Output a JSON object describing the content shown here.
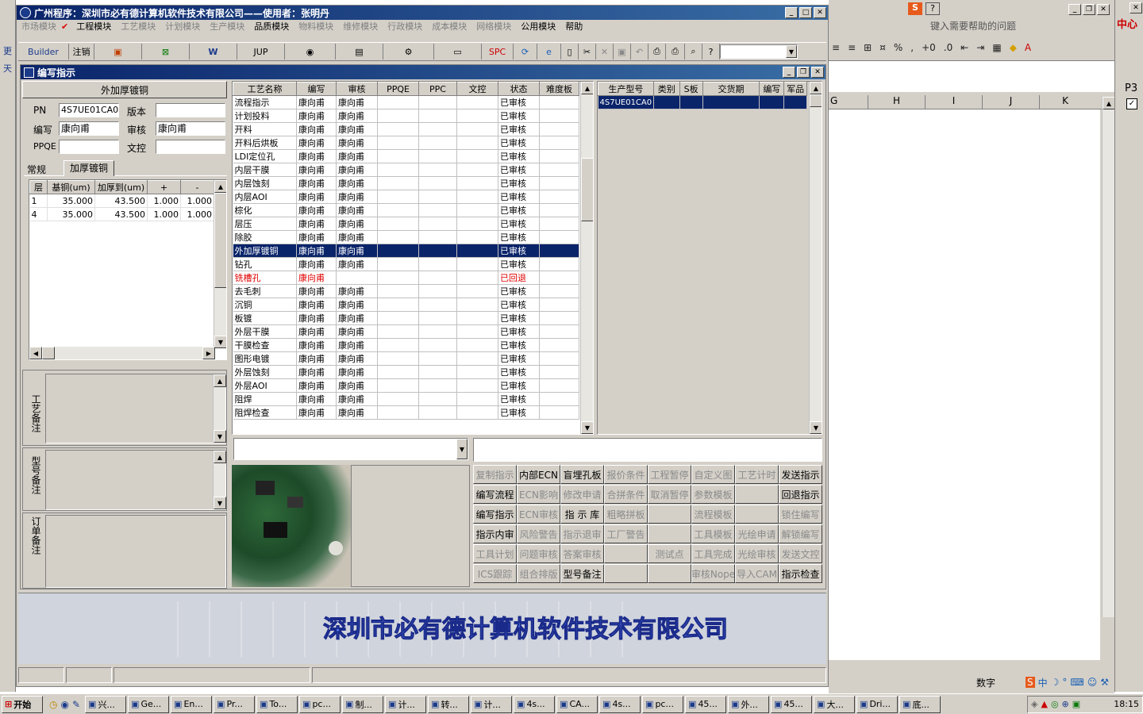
{
  "main_title": "广州程序：深圳市必有德计算机软件技术有限公司——使用者：张明丹",
  "menu": [
    {
      "label": "市场模块",
      "dis": true
    },
    {
      "label": "工程模块",
      "dis": false
    },
    {
      "label": "工艺模块",
      "dis": true
    },
    {
      "label": "计划模块",
      "dis": true
    },
    {
      "label": "生产模块",
      "dis": true
    },
    {
      "label": "品质模块",
      "dis": false
    },
    {
      "label": "物料模块",
      "dis": true
    },
    {
      "label": "维修模块",
      "dis": true
    },
    {
      "label": "行政模块",
      "dis": true
    },
    {
      "label": "成本模块",
      "dis": true
    },
    {
      "label": "网络模块",
      "dis": true
    },
    {
      "label": "公用模块",
      "dis": false
    },
    {
      "label": "帮助",
      "dis": false
    }
  ],
  "toolbar": {
    "builder": "Builder",
    "logout": "注销",
    "jup": "JUP",
    "spc": "SPC"
  },
  "child_title": "编写指示",
  "left": {
    "section_title": "外加厚镀铜",
    "pn_label": "PN",
    "pn_value": "4S7UE01CA0",
    "version_label": "版本",
    "version_value": "",
    "writer_label": "编写",
    "writer_value": "康向甫",
    "review_label": "审核",
    "review_value": "康向甫",
    "ppqe_label": "PPQE",
    "ppqe_value": "",
    "doc_label": "文控",
    "doc_value": "",
    "tabs": [
      "常规",
      "加厚镀铜"
    ],
    "layer_headers": [
      "层",
      "基铜(um)",
      "加厚到(um)",
      "+",
      "-"
    ],
    "layer_rows": [
      [
        "1",
        "35.000",
        "43.500",
        "1.000",
        "1.000"
      ],
      [
        "4",
        "35.000",
        "43.500",
        "1.000",
        "1.000"
      ]
    ],
    "note_labels": [
      "工艺备注",
      "型号备注",
      "订单备注"
    ]
  },
  "process": {
    "headers": [
      "工艺名称",
      "编写",
      "审核",
      "PPQE",
      "PPC",
      "文控",
      "状态",
      "难度板"
    ],
    "rows": [
      [
        "流程指示",
        "康向甫",
        "康向甫",
        "",
        "",
        "",
        "已审核",
        ""
      ],
      [
        "计划投料",
        "康向甫",
        "康向甫",
        "",
        "",
        "",
        "已审核",
        ""
      ],
      [
        "开料",
        "康向甫",
        "康向甫",
        "",
        "",
        "",
        "已审核",
        ""
      ],
      [
        "开料后烘板",
        "康向甫",
        "康向甫",
        "",
        "",
        "",
        "已审核",
        ""
      ],
      [
        "LDI定位孔",
        "康向甫",
        "康向甫",
        "",
        "",
        "",
        "已审核",
        ""
      ],
      [
        "内层干膜",
        "康向甫",
        "康向甫",
        "",
        "",
        "",
        "已审核",
        ""
      ],
      [
        "内层蚀刻",
        "康向甫",
        "康向甫",
        "",
        "",
        "",
        "已审核",
        ""
      ],
      [
        "内层AOI",
        "康向甫",
        "康向甫",
        "",
        "",
        "",
        "已审核",
        ""
      ],
      [
        "棕化",
        "康向甫",
        "康向甫",
        "",
        "",
        "",
        "已审核",
        ""
      ],
      [
        "层压",
        "康向甫",
        "康向甫",
        "",
        "",
        "",
        "已审核",
        ""
      ],
      [
        "除胶",
        "康向甫",
        "康向甫",
        "",
        "",
        "",
        "已审核",
        ""
      ],
      [
        "外加厚镀铜",
        "康向甫",
        "康向甫",
        "",
        "",
        "",
        "已审核",
        ""
      ],
      [
        "钻孔",
        "康向甫",
        "康向甫",
        "",
        "",
        "",
        "已审核",
        ""
      ],
      [
        "铣槽孔",
        "康向甫",
        "",
        "",
        "",
        "",
        "已回退",
        ""
      ],
      [
        "去毛刺",
        "康向甫",
        "康向甫",
        "",
        "",
        "",
        "已审核",
        ""
      ],
      [
        "沉铜",
        "康向甫",
        "康向甫",
        "",
        "",
        "",
        "已审核",
        ""
      ],
      [
        "板镀",
        "康向甫",
        "康向甫",
        "",
        "",
        "",
        "已审核",
        ""
      ],
      [
        "外层干膜",
        "康向甫",
        "康向甫",
        "",
        "",
        "",
        "已审核",
        ""
      ],
      [
        "干膜检查",
        "康向甫",
        "康向甫",
        "",
        "",
        "",
        "已审核",
        ""
      ],
      [
        "图形电镀",
        "康向甫",
        "康向甫",
        "",
        "",
        "",
        "已审核",
        ""
      ],
      [
        "外层蚀刻",
        "康向甫",
        "康向甫",
        "",
        "",
        "",
        "已审核",
        ""
      ],
      [
        "外层AOI",
        "康向甫",
        "康向甫",
        "",
        "",
        "",
        "已审核",
        ""
      ],
      [
        "阻焊",
        "康向甫",
        "康向甫",
        "",
        "",
        "",
        "已审核",
        ""
      ],
      [
        "阻焊检查",
        "康向甫",
        "康向甫",
        "",
        "",
        "",
        "已审核",
        ""
      ]
    ],
    "selected": 11,
    "rejected": 13
  },
  "product": {
    "headers": [
      "生产型号",
      "类别",
      "S板",
      "交货期",
      "编写",
      "军品"
    ],
    "rows": [
      [
        "4S7UE01CA0",
        "",
        "",
        "",
        "",
        ""
      ]
    ]
  },
  "buttons": [
    [
      {
        "t": "复制指示",
        "d": true
      },
      {
        "t": "内部ECN",
        "d": false
      },
      {
        "t": "盲埋孔板",
        "d": false
      },
      {
        "t": "报价条件",
        "d": true
      },
      {
        "t": "工程暂停",
        "d": true
      },
      {
        "t": "自定义图",
        "d": true
      },
      {
        "t": "工艺计时",
        "d": true
      },
      {
        "t": "发送指示",
        "d": false
      }
    ],
    [
      {
        "t": "编写流程",
        "d": false
      },
      {
        "t": "ECN影响",
        "d": true
      },
      {
        "t": "修改申请",
        "d": true
      },
      {
        "t": "合拼条件",
        "d": true
      },
      {
        "t": "取消暂停",
        "d": true
      },
      {
        "t": "参数模板",
        "d": true
      },
      {
        "t": "",
        "d": true
      },
      {
        "t": "回退指示",
        "d": false
      }
    ],
    [
      {
        "t": "编写指示",
        "d": false
      },
      {
        "t": "ECN审核",
        "d": true
      },
      {
        "t": "指 示 库",
        "d": false
      },
      {
        "t": "粗略拼板",
        "d": true
      },
      {
        "t": "",
        "d": true
      },
      {
        "t": "流程模板",
        "d": true
      },
      {
        "t": "",
        "d": true
      },
      {
        "t": "锁住编写",
        "d": true
      }
    ],
    [
      {
        "t": "指示内审",
        "d": false
      },
      {
        "t": "风险警告",
        "d": true
      },
      {
        "t": "指示退审",
        "d": true
      },
      {
        "t": "工厂警告",
        "d": true
      },
      {
        "t": "",
        "d": true
      },
      {
        "t": "工具模板",
        "d": true
      },
      {
        "t": "光绘申请",
        "d": true
      },
      {
        "t": "解锁编写",
        "d": true
      }
    ],
    [
      {
        "t": "工具计划",
        "d": true
      },
      {
        "t": "问题审核",
        "d": true
      },
      {
        "t": "答案审核",
        "d": true
      },
      {
        "t": "",
        "d": true
      },
      {
        "t": "测试点",
        "d": true
      },
      {
        "t": "工具完成",
        "d": true
      },
      {
        "t": "光绘审核",
        "d": true
      },
      {
        "t": "发送文控",
        "d": true
      }
    ],
    [
      {
        "t": "ICS跟踪",
        "d": true
      },
      {
        "t": "组合排版",
        "d": true
      },
      {
        "t": "型号备注",
        "d": false
      },
      {
        "t": "",
        "d": true
      },
      {
        "t": "",
        "d": true
      },
      {
        "t": "审核Nope",
        "d": true
      },
      {
        "t": "导入CAM",
        "d": true
      },
      {
        "t": "指示检查",
        "d": false
      }
    ]
  ],
  "company_banner": "深圳市必有德计算机软件技术有限公司",
  "excel": {
    "help_placeholder": "键入需要帮助的问题",
    "cols": [
      "G",
      "H",
      "I",
      "J",
      "K"
    ],
    "status": "数字",
    "far_label1": "中心",
    "far_label2": "P3"
  },
  "taskbar": {
    "start": "开始",
    "items": [
      "兴...",
      "Ge...",
      "En...",
      "Pr...",
      "To...",
      "pc...",
      "制...",
      "计...",
      "转...",
      "计...",
      "4s...",
      "CA...",
      "4s...",
      "pc...",
      "45...",
      "外...",
      "45...",
      "大...",
      "Dri...",
      "底..."
    ],
    "clock": "18:15"
  }
}
